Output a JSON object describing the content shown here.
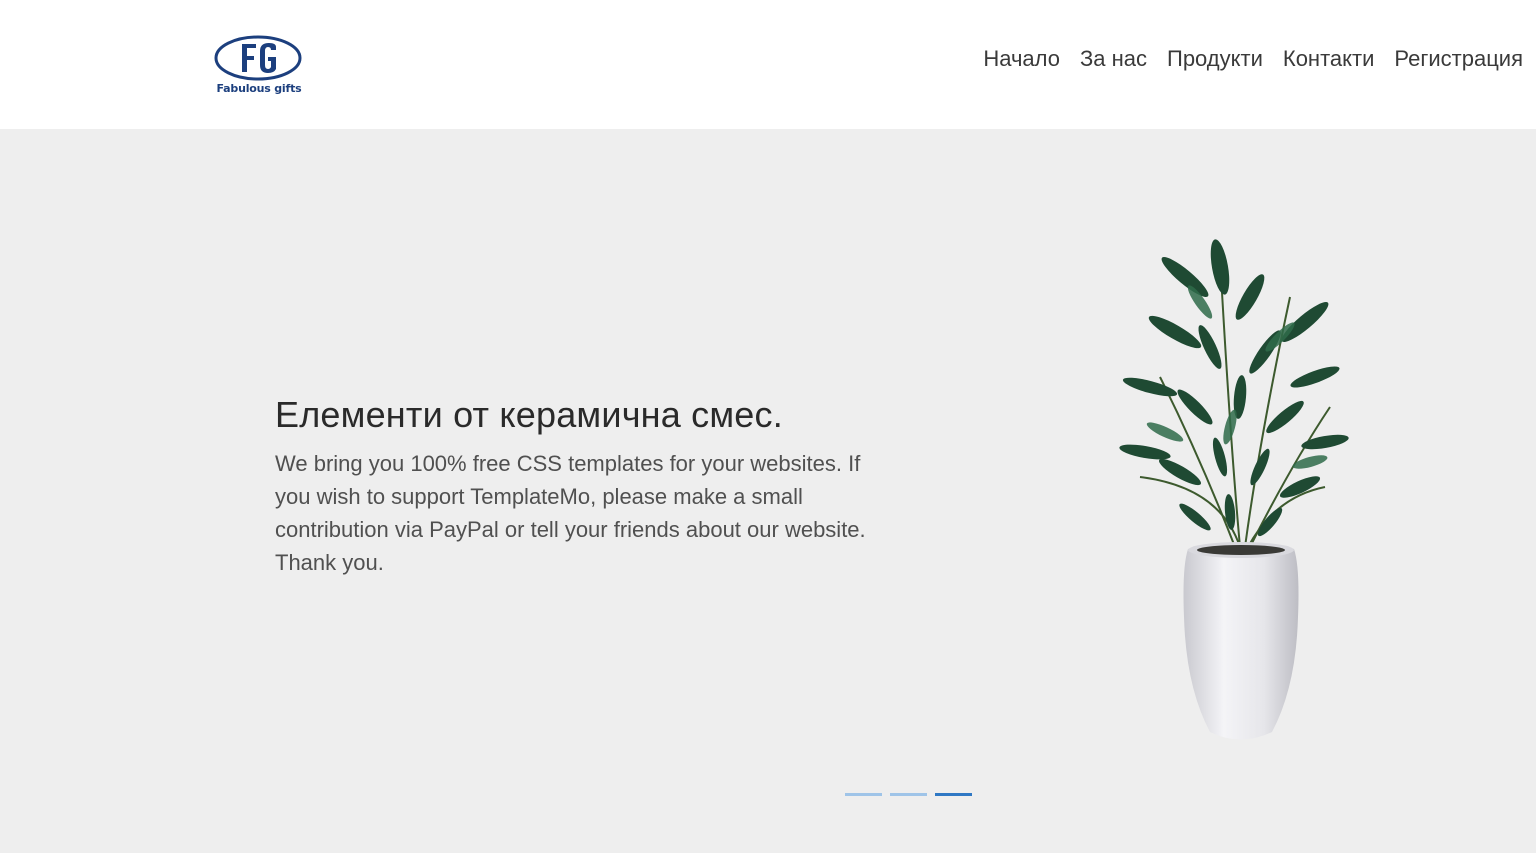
{
  "brand": {
    "tagline": "Fabulous gifts",
    "monogram": "FG",
    "color": "#1c3f7e"
  },
  "nav": {
    "items": [
      "Начало",
      "За нас",
      "Продукти",
      "Контакти",
      "Регистрация"
    ]
  },
  "hero": {
    "title": "Елементи от керамична смес.",
    "description": "We bring you 100% free CSS templates for your websites. If you wish to support TemplateMo, please make a small contribution via PayPal or tell your friends about our website. Thank you.",
    "image": "plant-in-white-vase",
    "background": "#eeeeee"
  },
  "carousel": {
    "slide_count": 3,
    "active_index": 2,
    "active_color": "#2f78c4",
    "inactive_color": "#9fc4e8"
  }
}
